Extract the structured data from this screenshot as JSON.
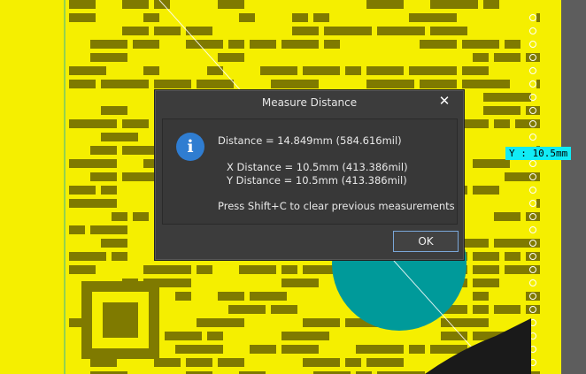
{
  "dialog": {
    "title": "Measure Distance",
    "close_symbol": "✕",
    "icon": "info-icon",
    "distance": "Distance = 14.849mm (584.616mil)",
    "x_distance": "X Distance = 10.5mm (413.386mil)",
    "y_distance": "Y Distance = 10.5mm (413.386mil)",
    "hint": "Press Shift+C to clear previous measurements",
    "ok_label": "OK"
  },
  "overlay": {
    "y_readout": "Y : 10.5mm"
  },
  "colors": {
    "board": "#f5ef00",
    "copper": "#7f7a00",
    "pad": "#009a9a",
    "measure_label": "#11ebf5",
    "dialog_bg": "#3c3c3c",
    "info_blue": "#2f7dd1"
  }
}
